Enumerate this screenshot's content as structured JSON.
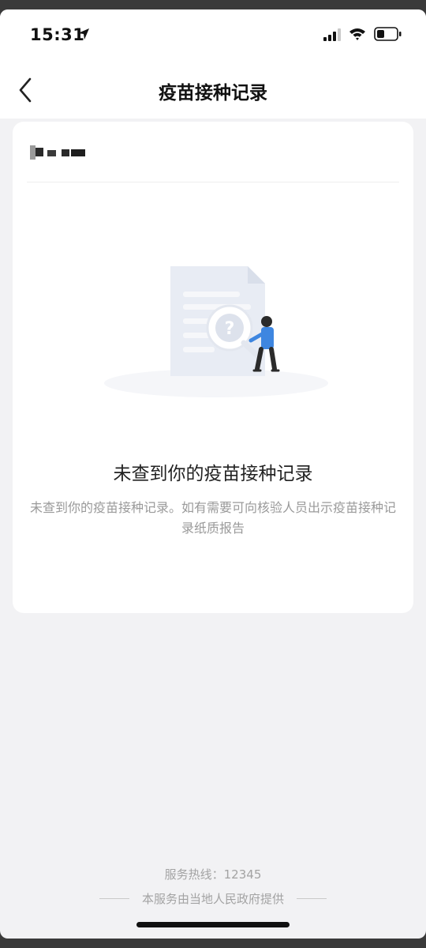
{
  "status_bar": {
    "time": "15:31",
    "icons": [
      "location-arrow-icon",
      "signal-icon",
      "wifi-icon",
      "battery-icon"
    ]
  },
  "nav": {
    "title": "疫苗接种记录",
    "back_icon": "chevron-left-icon"
  },
  "card": {
    "empty_title": "未查到你的疫苗接种记录",
    "empty_description": "未查到你的疫苗接种记录。如有需要可向核验人员出示疫苗接种记录纸质报告"
  },
  "footer": {
    "hotline": "服务热线：12345",
    "provider": "本服务由当地人民政府提供"
  },
  "colors": {
    "page_background": "#f2f2f4",
    "card_background": "#ffffff",
    "secondary_text": "#9a9a9a",
    "figure_shirt": "#3e86e0"
  }
}
